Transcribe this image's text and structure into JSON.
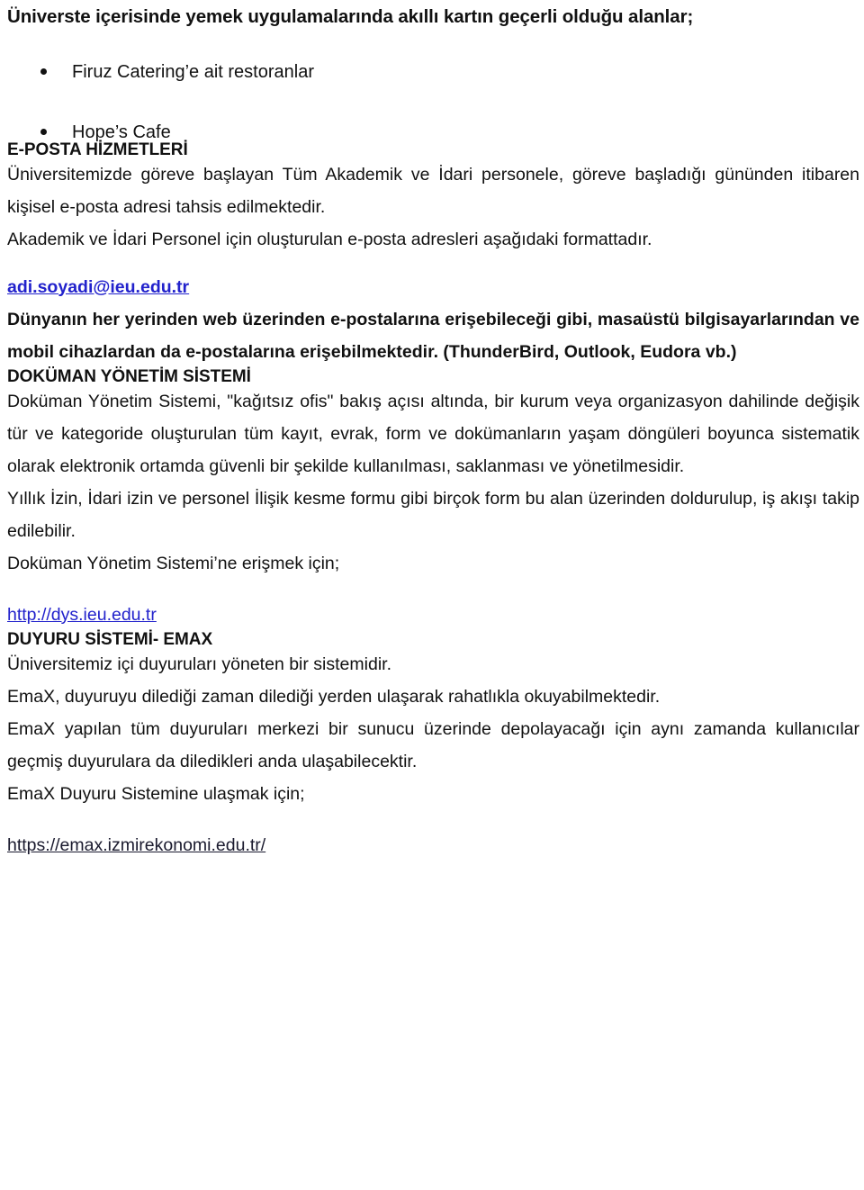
{
  "document": {
    "title": "Üniverste içerisinde yemek uygulamalarında akıllı kartın geçerli olduğu alanlar;",
    "bullets": [
      {
        "label": "Firuz Catering’e ait restoranlar"
      },
      {
        "label": "Hope’s Cafe"
      }
    ],
    "sections": [
      {
        "heading": "E-POSTA HİZMETLERİ",
        "paragraph_1": "Üniversitemizde göreve başlayan Tüm Akademik ve İdari personele, göreve başladığı gününden itibaren kişisel e-posta adresi tahsis edilmektedir.",
        "paragraph_2": "Akademik ve İdari Personel için oluşturulan e-posta adresleri aşağıdaki formattadır.",
        "email_format": "adi.soyadi@ieu.edu.tr",
        "paragraph_3": "Dünyanın her yerinden web üzerinden e-postalarına erişebileceği gibi, masaüstü bilgisayarlarından ve mobil cihazlardan da e-postalarına erişebilmektedir. (ThunderBird, Outlook, Eudora vb.)"
      },
      {
        "heading": "DOKÜMAN YÖNETİM SİSTEMİ",
        "paragraph_1": "Doküman Yönetim Sistemi, \"kağıtsız ofis\" bakış açısı altında, bir kurum veya organizasyon dahilinde değişik tür ve kategoride oluşturulan tüm kayıt, evrak, form ve dokümanların yaşam döngüleri boyunca sistematik olarak elektronik ortamda güvenli bir şekilde kullanılması, saklanması ve yönetilmesidir.",
        "paragraph_2": "Yıllık İzin, İdari izin ve personel İlişik kesme formu gibi birçok form bu alan üzerinden doldurulup, iş akışı takip edilebilir.",
        "access_label": "Doküman Yönetim Sistemi’ne erişmek için;",
        "access_link": "http://dys.ieu.edu.tr"
      },
      {
        "heading": "DUYURU SİSTEMİ- EMAX",
        "paragraph_1": "Üniversitemiz içi duyuruları yöneten bir sistemidir.",
        "paragraph_2": "EmaX, duyuruyu dilediği zaman dilediği yerden ulaşarak rahatlıkla okuyabilmektedir.",
        "paragraph_3": "EmaX yapılan tüm duyuruları merkezi bir sunucu üzerinde depolayacağı için aynı zamanda kullanıcılar geçmiş duyurulara da diledikleri anda ulaşabilecektir.",
        "access_label": "EmaX Duyuru Sistemine  ulaşmak için;",
        "access_link": "https://emax.izmirekonomi.edu.tr/"
      }
    ],
    "colors": {
      "text": "#111111",
      "link": "#2222CC",
      "link_dark": "#1a1a2e",
      "background": "#ffffff"
    }
  }
}
